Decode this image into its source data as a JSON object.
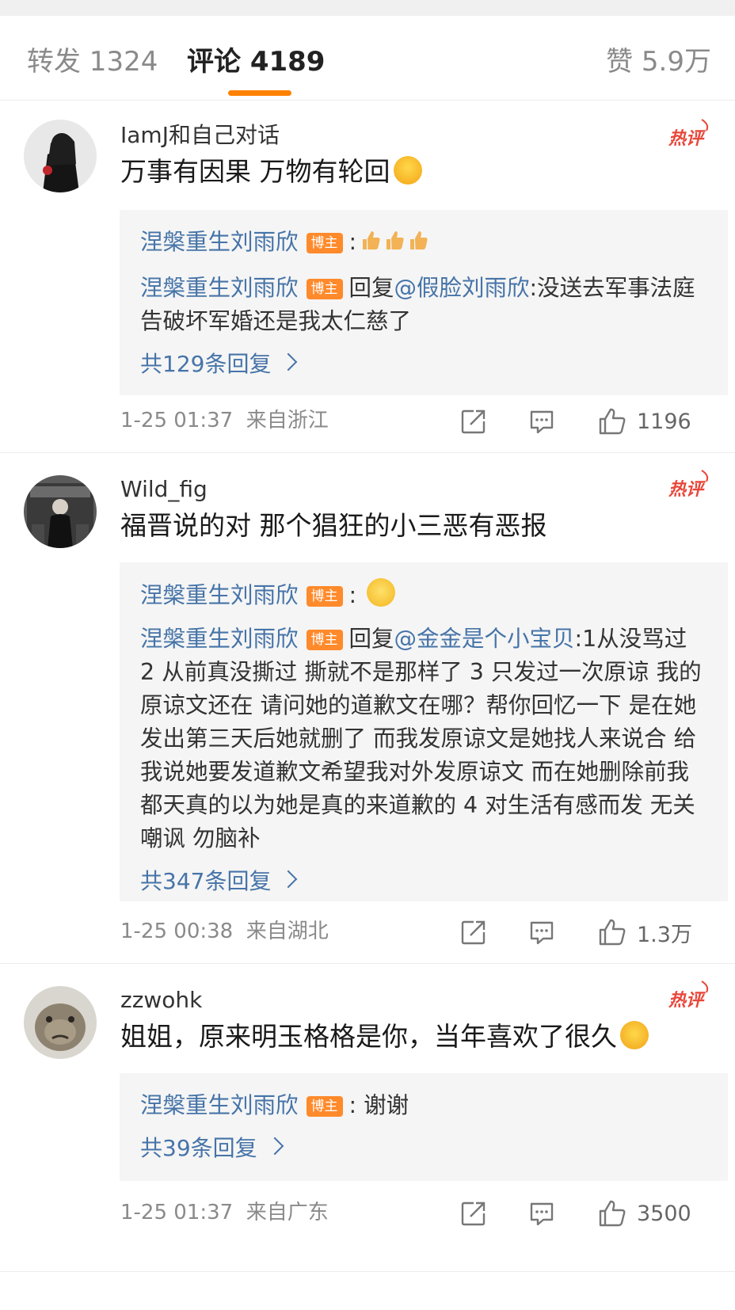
{
  "tabs": [
    {
      "label": "转发 1324"
    },
    {
      "label": "评论 4189"
    },
    {
      "label": "赞 5.9万"
    }
  ],
  "hot_label": "热评",
  "blogger_badge": "博主",
  "comments": [
    {
      "user": "IamJ和自己对话",
      "text": "万事有因果 万物有轮回",
      "emoji": "laugh-cry-emoji",
      "replies": [
        {
          "name": "涅槃重生刘雨欣",
          "sep": ":",
          "text": "",
          "thumbs": 3
        },
        {
          "name": "涅槃重生刘雨欣",
          "prefix": "回复",
          "mention": "@假脸刘雨欣",
          "sep": ":",
          "text": "没送去军事法庭 告破坏军婚还是我太仁慈了"
        }
      ],
      "more": "共129条回复",
      "time": "1-25 01:37",
      "location": "来自浙江",
      "likes": "1196"
    },
    {
      "user": "Wild_fig",
      "text": "福晋说的对 那个猖狂的小三恶有恶报",
      "replies": [
        {
          "name": "涅槃重生刘雨欣",
          "sep": ":",
          "text": "",
          "smile": true
        },
        {
          "name": "涅槃重生刘雨欣",
          "prefix": "回复",
          "mention": "@金金是个小宝贝",
          "sep": ":",
          "text": "1从没骂过  2 从前真没撕过 撕就不是那样了 3 只发过一次原谅 我的原谅文还在 请问她的道歉文在哪？帮你回忆一下 是在她发出第三天后她就删了  而我发原谅文是她找人来说合 给我说她要发道歉文希望我对外发原谅文 而在她删除前我都天真的以为她是真的来道歉的   4 对生活有感而发 无关嘲讽  勿脑补"
        }
      ],
      "more": "共347条回复",
      "time": "1-25 00:38",
      "location": "来自湖北",
      "likes": "1.3万"
    },
    {
      "user": "zzwohk",
      "text": "姐姐，原来明玉格格是你，当年喜欢了很久",
      "emoji": "blush-emoji",
      "replies": [
        {
          "name": "涅槃重生刘雨欣",
          "sep": ":",
          "text": " 谢谢"
        }
      ],
      "more": "共39条回复",
      "time": "1-25 01:37",
      "location": "来自广东",
      "likes": "3500"
    }
  ],
  "colors": {
    "accent": "#ff8200",
    "link": "#4674a8",
    "hot": "#e8473a",
    "badge": "#ff8a2b"
  }
}
